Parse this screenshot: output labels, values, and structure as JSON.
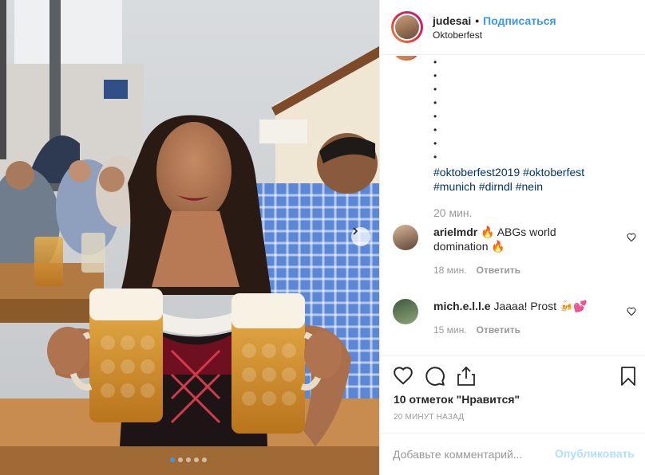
{
  "post": {
    "username": "judesai",
    "separator": "•",
    "follow_label": "Подписаться",
    "location": "Oktoberfest",
    "image_dots": 5,
    "active_dot": 0
  },
  "caption": {
    "bullets": [
      "•",
      "•",
      "•",
      "•",
      "•",
      "•",
      "•",
      "•"
    ],
    "hashtags": [
      "#oktoberfest2019",
      "#oktoberfest",
      "#munich",
      "#dirndl",
      "#nein"
    ],
    "time": "20 мин."
  },
  "comments": [
    {
      "username": "arielmdr",
      "text": "🔥 ABGs world domination 🔥",
      "time": "18 мин.",
      "reply_label": "Ответить"
    },
    {
      "username": "mich.e.l.l.e",
      "text": "Jaaaa! Prost 🍻💕",
      "time": "15 мин.",
      "reply_label": "Ответить"
    }
  ],
  "actions": {
    "like_icon": "heart-icon",
    "comment_icon": "comment-icon",
    "share_icon": "share-icon",
    "save_icon": "bookmark-icon",
    "likes_text": "10 отметок \"Нравится\"",
    "timestamp": "20 МИНУТ НАЗАД"
  },
  "add_comment": {
    "placeholder": "Добавьте комментарий...",
    "publish_label": "Опубликовать"
  },
  "colors": {
    "link": "#3897f0",
    "hashtag": "#003569",
    "muted": "#999999",
    "publish_disabled": "#b2dffc"
  }
}
